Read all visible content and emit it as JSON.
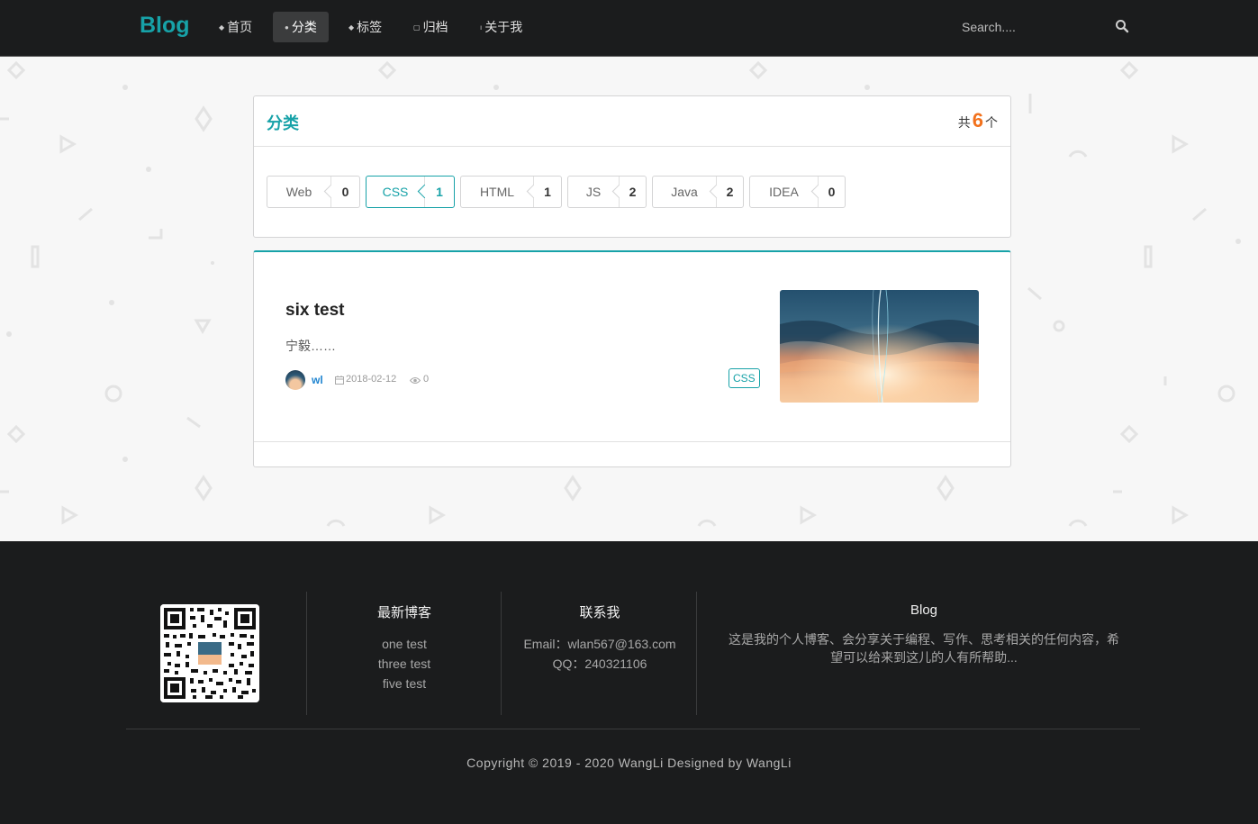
{
  "navbar": {
    "brand": "Blog",
    "items": [
      {
        "label": "首页",
        "active": false
      },
      {
        "label": "分类",
        "active": true
      },
      {
        "label": "标签",
        "active": false
      },
      {
        "label": "归档",
        "active": false
      },
      {
        "label": "关于我",
        "active": false
      }
    ],
    "search_placeholder": "Search...."
  },
  "categories": {
    "title": "分类",
    "count_prefix": "共",
    "count": "6",
    "count_suffix": "个",
    "items": [
      {
        "name": "Web",
        "count": "0",
        "active": false
      },
      {
        "name": "CSS",
        "count": "1",
        "active": true
      },
      {
        "name": "HTML",
        "count": "1",
        "active": false
      },
      {
        "name": "JS",
        "count": "2",
        "active": false
      },
      {
        "name": "Java",
        "count": "2",
        "active": false
      },
      {
        "name": "IDEA",
        "count": "0",
        "active": false
      }
    ]
  },
  "post": {
    "title": "six test",
    "excerpt": "宁毅……",
    "author": "wl",
    "date": "2018-02-12",
    "views": "0",
    "tag": "CSS"
  },
  "footer": {
    "latest_title": "最新博客",
    "latest": [
      "one test",
      "three test",
      "five test"
    ],
    "contact_title": "联系我",
    "email": "Email：wlan567@163.com",
    "qq": "QQ：240321106",
    "about_title": "Blog",
    "about_line1": "这是我的个人博客、会分享关于编程、写作、思考相关的任何内容，希",
    "about_line2": "望可以给来到这儿的人有所帮助...",
    "copyright": "Copyright © 2019 - 2020 WangLi Designed by WangLi"
  },
  "colors": {
    "accent": "#17a2a8",
    "count_highlight": "#f2711c",
    "navbar_bg": "#1b1c1d",
    "footer_bg": "#1b1c1d"
  }
}
